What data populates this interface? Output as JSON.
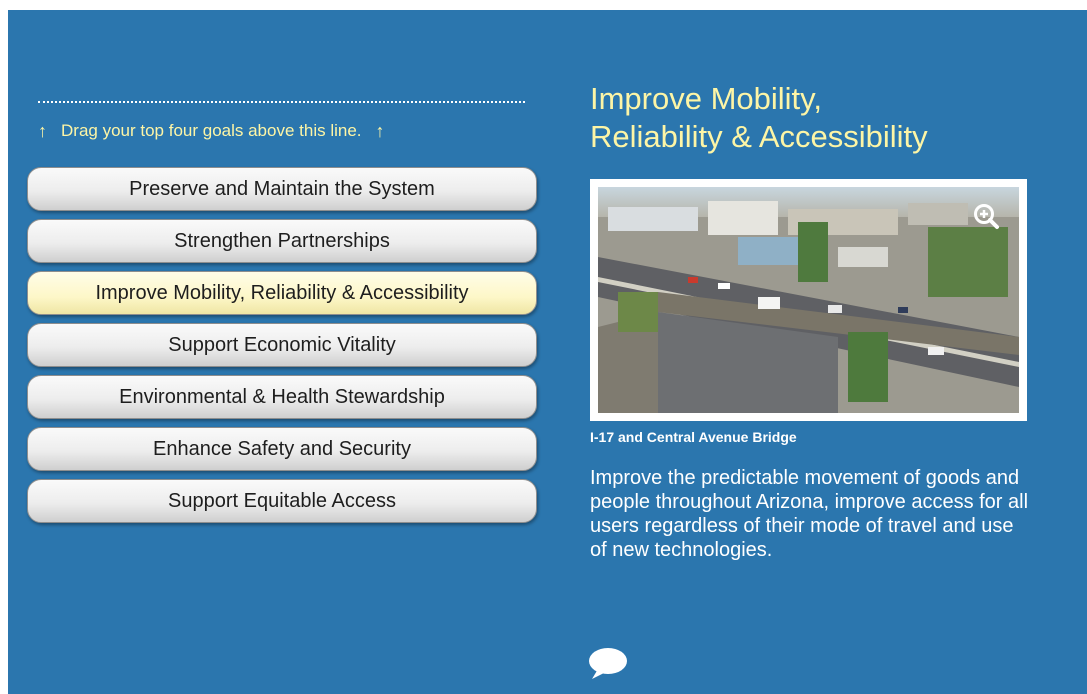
{
  "instructions": {
    "hint_text": "Drag your top four goals above this line.",
    "arrow_glyph": "↑"
  },
  "goals": [
    {
      "label": "Preserve and Maintain the System",
      "selected": false
    },
    {
      "label": "Strengthen Partnerships",
      "selected": false
    },
    {
      "label": "Improve Mobility, Reliability & Accessibility",
      "selected": true
    },
    {
      "label": "Support Economic Vitality",
      "selected": false
    },
    {
      "label": "Environmental & Health Stewardship",
      "selected": false
    },
    {
      "label": "Enhance Safety and Security",
      "selected": false
    },
    {
      "label": "Support Equitable Access",
      "selected": false
    }
  ],
  "detail": {
    "title_line1": "Improve Mobility,",
    "title_line2": "Reliability & Accessibility",
    "image_caption": "I-17 and Central Avenue Bridge",
    "description": "Improve the predictable movement of goods and people throughout Arizona, improve access for all users regardless of their mode of travel and use of new technologies.",
    "zoom_icon": "zoom-in-icon",
    "comment_icon": "speech-bubble-icon"
  },
  "colors": {
    "panel_bg": "#2b76ae",
    "accent_yellow": "#fdf5a6",
    "selected_goal": "#fdf7c8"
  }
}
